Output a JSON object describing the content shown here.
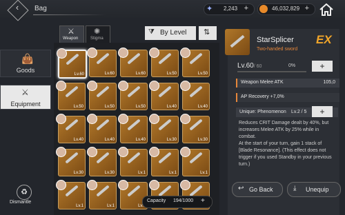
{
  "header": {
    "title": "Bag",
    "currency1_value": "2,243",
    "currency2_value": "46,032,829",
    "plus": "+"
  },
  "sidebar": {
    "items": [
      {
        "label": "Goods"
      },
      {
        "label": "Equipment"
      }
    ],
    "dismantle_label": "Dismantle"
  },
  "filters": {
    "weapon_label": "Weapon",
    "stigma_label": "Stigma",
    "sort_label": "By Level"
  },
  "grid": {
    "cells": [
      {
        "lv": "Lv.60"
      },
      {
        "lv": "Lv.60"
      },
      {
        "lv": "Lv.60"
      },
      {
        "lv": "Lv.50"
      },
      {
        "lv": "Lv.50"
      },
      {
        "lv": "Lv.50"
      },
      {
        "lv": "Lv.50"
      },
      {
        "lv": "Lv.50"
      },
      {
        "lv": "Lv.40"
      },
      {
        "lv": "Lv.40"
      },
      {
        "lv": "Lv.40"
      },
      {
        "lv": "Lv.40"
      },
      {
        "lv": "Lv.40"
      },
      {
        "lv": "Lv.30"
      },
      {
        "lv": "Lv.30"
      },
      {
        "lv": "Lv.30"
      },
      {
        "lv": "Lv.30"
      },
      {
        "lv": "Lv.1"
      },
      {
        "lv": "Lv.1"
      },
      {
        "lv": "Lv.1"
      },
      {
        "lv": "Lv.1"
      },
      {
        "lv": "Lv.1"
      },
      {
        "lv": "Lv.1"
      },
      {
        "lv": "Lv.1"
      },
      {
        "lv": "Lv.1"
      }
    ],
    "capacity_label": "Capacity",
    "capacity_value": "194/1000"
  },
  "detail": {
    "name": "StarSplicer",
    "type": "Two-handed sword",
    "logo": "EX",
    "level": "Lv.60",
    "level_max": "/ 60",
    "level_pct": "0%",
    "level_progress": 0,
    "stat_name": "Weapon Melee ATK",
    "stat_value": "105,0",
    "sub_stat": "AP Recovery +7,0%",
    "unique_label": "Unique: Phenomenon",
    "unique_lv": "Lv.2 / 5",
    "description": "Reduces CRIT Damage dealt by 40%, but increases Melee ATK by 25% while in combat.\nAt the start of your turn, gain 1 stack of [Blade Resonance]. (This effect does not trigger if you used Standby in your previous turn.)",
    "go_back_label": "Go Back",
    "unequip_label": "Unequip"
  },
  "colors": {
    "accent": "#e8873a",
    "logo": "#f2a62a",
    "cell_gold": "#b0772a",
    "panel": "#2c2f35"
  },
  "icons": [
    "back-icon",
    "butterfly-icon",
    "coin-icon",
    "home-icon",
    "bag-icon",
    "sword-icon",
    "recycle-icon",
    "filter-icon",
    "sort-icon"
  ]
}
